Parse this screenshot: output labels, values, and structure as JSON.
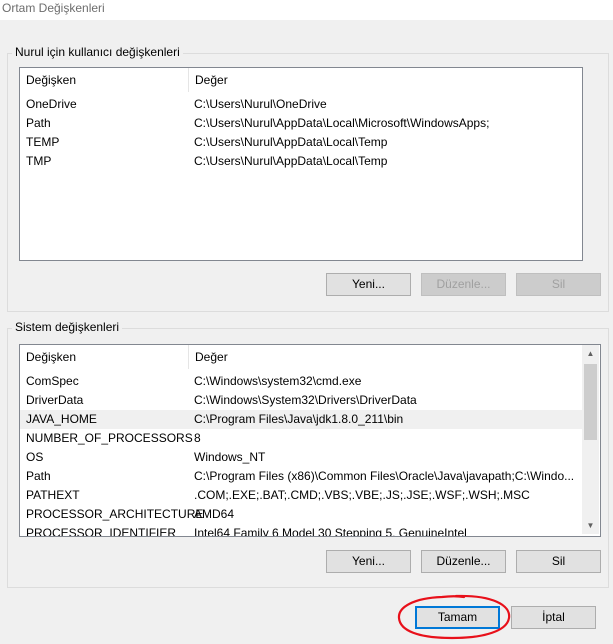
{
  "window": {
    "title": "Ortam Değişkenleri"
  },
  "user_section": {
    "label": "Nurul için kullanıcı değişkenleri",
    "columns": [
      "Değişken",
      "Değer"
    ],
    "rows": [
      {
        "name": "OneDrive",
        "value": "C:\\Users\\Nurul\\OneDrive"
      },
      {
        "name": "Path",
        "value": "C:\\Users\\Nurul\\AppData\\Local\\Microsoft\\WindowsApps;"
      },
      {
        "name": "TEMP",
        "value": "C:\\Users\\Nurul\\AppData\\Local\\Temp"
      },
      {
        "name": "TMP",
        "value": "C:\\Users\\Nurul\\AppData\\Local\\Temp"
      }
    ],
    "buttons": {
      "new": "Yeni...",
      "edit": "Düzenle...",
      "delete": "Sil"
    }
  },
  "system_section": {
    "label": "Sistem değişkenleri",
    "columns": [
      "Değişken",
      "Değer"
    ],
    "rows": [
      {
        "name": "ComSpec",
        "value": "C:\\Windows\\system32\\cmd.exe"
      },
      {
        "name": "DriverData",
        "value": "C:\\Windows\\System32\\Drivers\\DriverData"
      },
      {
        "name": "JAVA_HOME",
        "value": "C:\\Program Files\\Java\\jdk1.8.0_211\\bin"
      },
      {
        "name": "NUMBER_OF_PROCESSORS",
        "value": "8"
      },
      {
        "name": "OS",
        "value": "Windows_NT"
      },
      {
        "name": "Path",
        "value": "C:\\Program Files (x86)\\Common Files\\Oracle\\Java\\javapath;C:\\Windo..."
      },
      {
        "name": "PATHEXT",
        "value": ".COM;.EXE;.BAT;.CMD;.VBS;.VBE;.JS;.JSE;.WSF;.WSH;.MSC"
      },
      {
        "name": "PROCESSOR_ARCHITECTURE",
        "value": "AMD64"
      },
      {
        "name": "PROCESSOR_IDENTIFIER",
        "value": "Intel64 Family 6 Model 30 Stepping 5, GenuineIntel"
      }
    ],
    "buttons": {
      "new": "Yeni...",
      "edit": "Düzenle...",
      "delete": "Sil"
    }
  },
  "footer": {
    "ok": "Tamam",
    "cancel": "İptal"
  },
  "colors": {
    "annotation_circle": "#e8101a",
    "default_button_border": "#0078d7"
  }
}
